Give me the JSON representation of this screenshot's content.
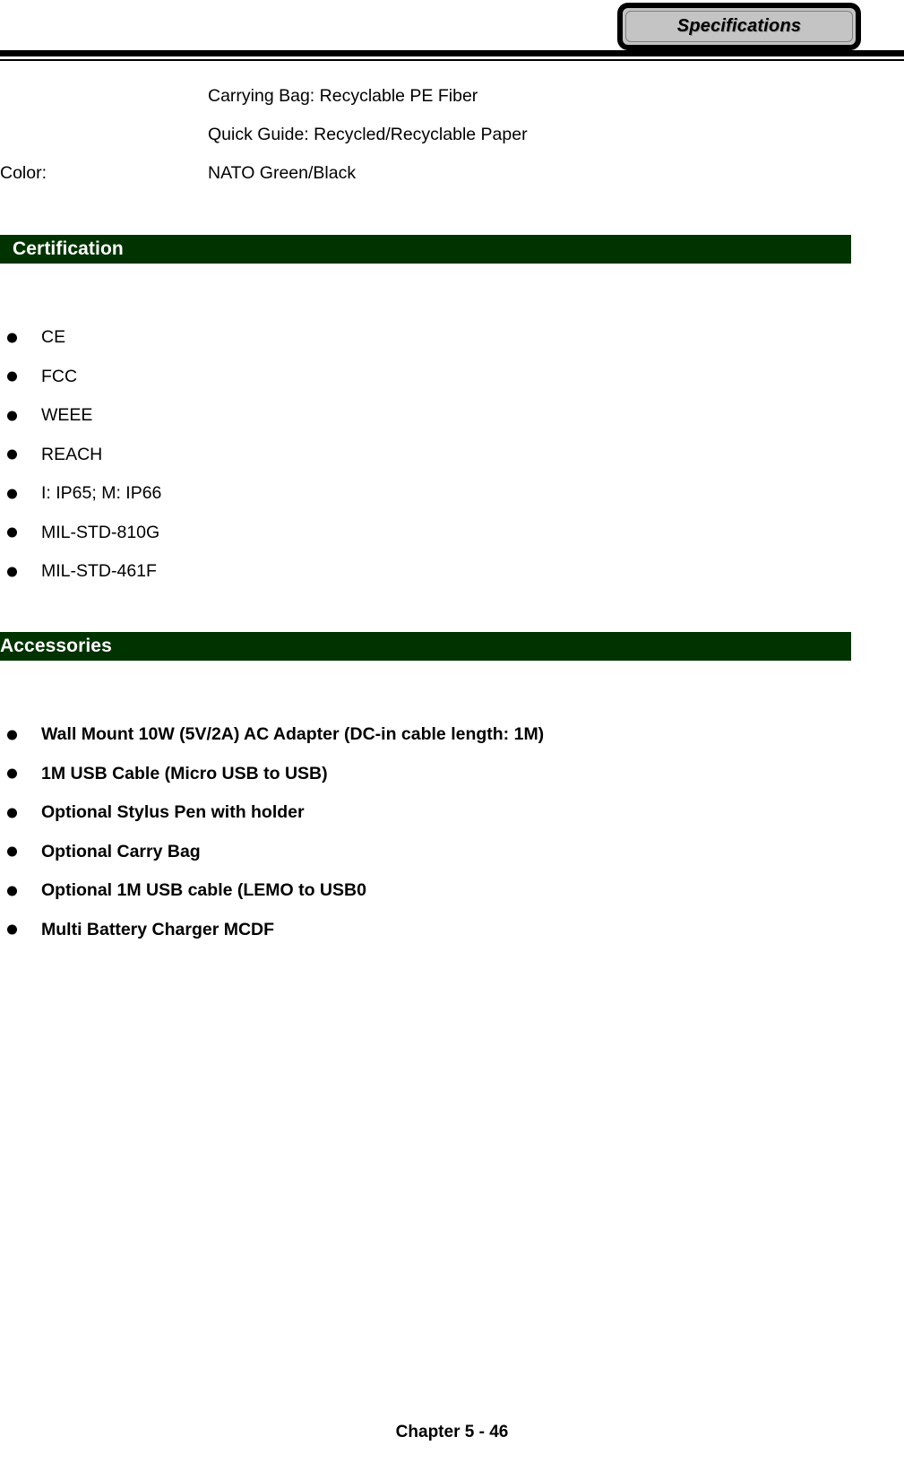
{
  "header": {
    "tab_label": "Specifications"
  },
  "spec_rows": [
    {
      "label": "",
      "value": "Carrying Bag: Recyclable PE Fiber"
    },
    {
      "label": "",
      "value": "Quick Guide: Recycled/Recyclable Paper"
    },
    {
      "label": "Color:",
      "value": "NATO Green/Black"
    }
  ],
  "sections": {
    "certification": {
      "title": "Certification",
      "items": [
        "CE",
        "FCC",
        "WEEE",
        "REACH",
        "I: IP65; M: IP66",
        "MIL-STD-810G",
        "MIL-STD-461F"
      ]
    },
    "accessories": {
      "title": "Accessories",
      "items": [
        "Wall Mount 10W (5V/2A) AC Adapter (DC-in cable length: 1M)",
        "1M USB Cable (Micro USB to USB)",
        "Optional Stylus Pen with holder",
        "Optional Carry Bag",
        "Optional 1M USB cable (LEMO to USB0",
        "Multi Battery Charger MCDF"
      ]
    }
  },
  "footer": {
    "text": "Chapter 5 - 46"
  },
  "colors": {
    "section_bar_bg": "#013300",
    "section_bar_text": "#ffffff",
    "header_tab_bg": "#c4c4c4",
    "rule": "#000000"
  }
}
